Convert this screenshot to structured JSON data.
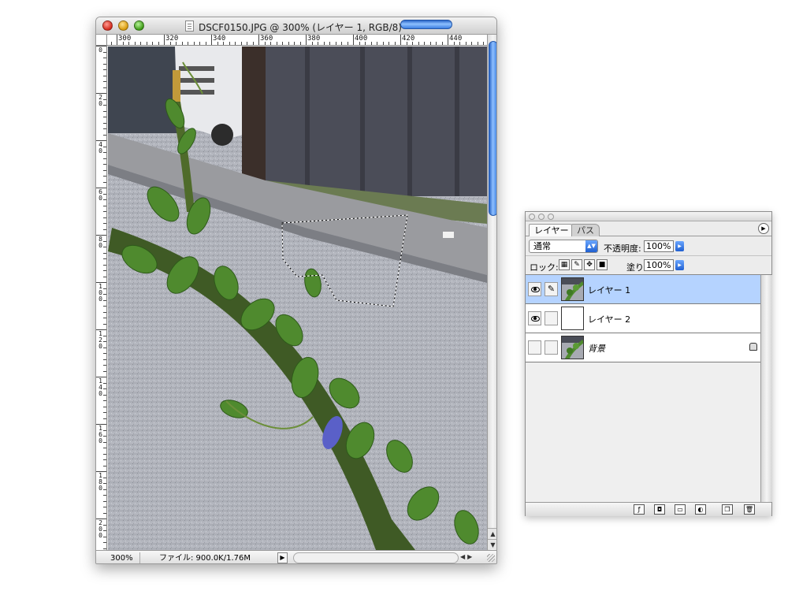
{
  "document": {
    "title": "DSCF0150.JPG @ 300% (レイヤー 1, RGB/8)",
    "zoom": "300%",
    "status": "ファイル: 900.0K/1.76M",
    "ruler_h": [
      "300",
      "320",
      "340",
      "360",
      "380",
      "400",
      "420",
      "440"
    ],
    "ruler_v": [
      "0",
      "20",
      "40",
      "60",
      "80",
      "100",
      "120",
      "140",
      "160",
      "180",
      "200"
    ]
  },
  "layers_panel": {
    "tabs": [
      "レイヤー",
      "パス"
    ],
    "blend_mode": "通常",
    "opacity_label": "不透明度:",
    "opacity": "100%",
    "lock_label": "ロック:",
    "fill_label": "塗り:",
    "fill": "100%",
    "layers": [
      {
        "name": "レイヤー 1",
        "visible": true,
        "selected": true,
        "editing": true,
        "locked": false
      },
      {
        "name": "レイヤー 2",
        "visible": true,
        "selected": false,
        "editing": false,
        "locked": false
      },
      {
        "name": "背景",
        "visible": false,
        "selected": false,
        "editing": false,
        "locked": true
      }
    ],
    "bottom_buttons": [
      "layer-style-icon",
      "layer-mask-icon",
      "new-group-icon",
      "adjustment-layer-icon",
      "new-layer-icon",
      "trash-icon"
    ]
  },
  "colors": {
    "selection_blue": "#b5d3ff",
    "scroll_blue": "#3c7ee0"
  }
}
